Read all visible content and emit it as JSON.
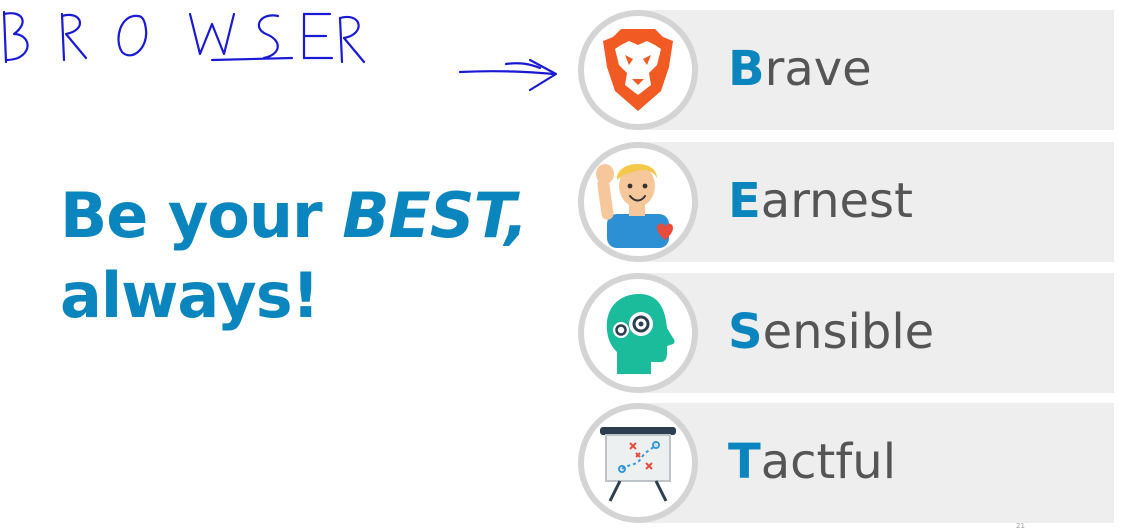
{
  "annotation": {
    "handwritten_text": "BROWSER",
    "arrow_icon": "hand-drawn-arrow-icon",
    "ink_color": "#1a1ad6"
  },
  "slogan": {
    "line1_prefix": "Be your ",
    "line1_emphasis": "BEST,",
    "line2": "always!",
    "color": "#0a85bd"
  },
  "values": [
    {
      "initial": "B",
      "rest": "rave",
      "icon": "brave-lion-icon"
    },
    {
      "initial": "E",
      "rest": "arnest",
      "icon": "waving-person-icon"
    },
    {
      "initial": "S",
      "rest": "ensible",
      "icon": "head-gears-icon"
    },
    {
      "initial": "T",
      "rest": "actful",
      "icon": "strategy-board-icon"
    }
  ],
  "colors": {
    "accent": "#0a85bd",
    "word_text": "#555555",
    "band": "#eeeeee",
    "circle_border": "#d4d4d4",
    "brave_orange": "#f15a22"
  },
  "footer_mark": "21"
}
